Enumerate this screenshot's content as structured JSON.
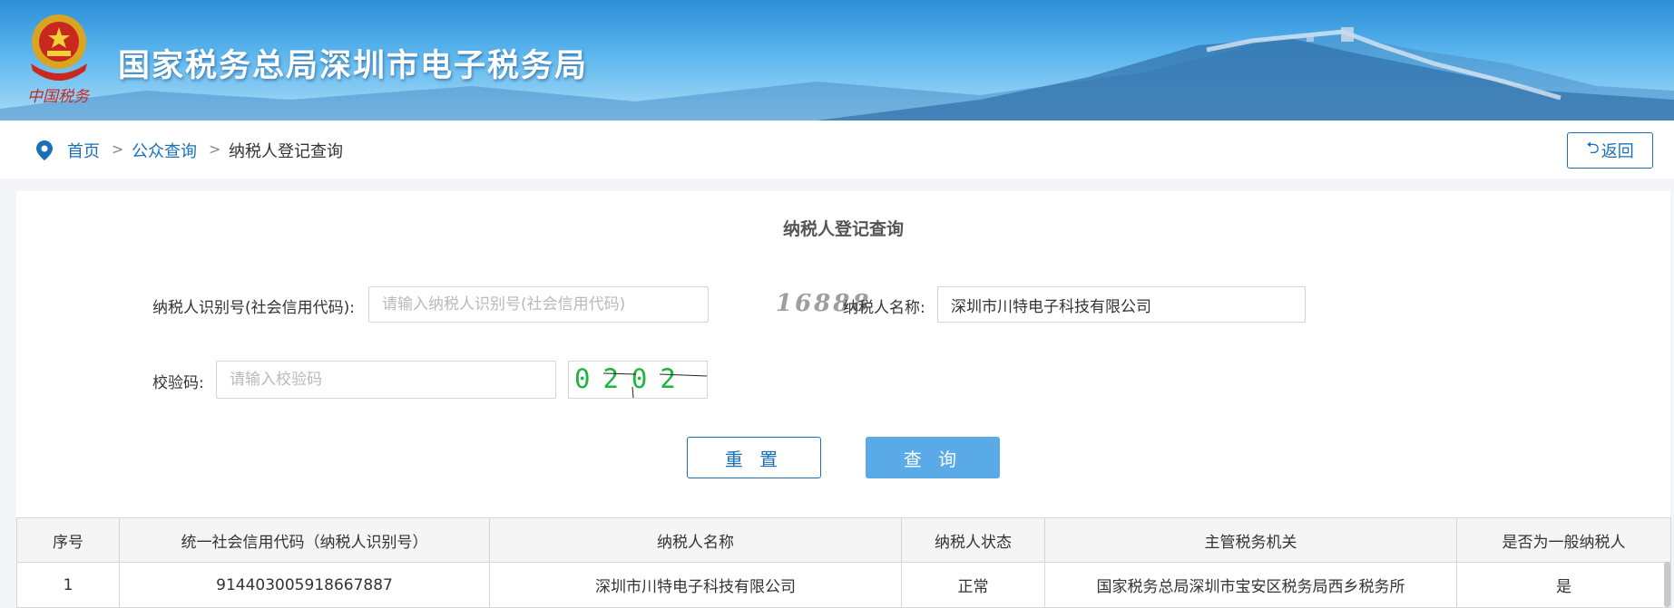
{
  "banner": {
    "title": "国家税务总局深圳市电子税务局",
    "logo_text": "中国税务",
    "emblem": "national-emblem-icon"
  },
  "breadcrumb": {
    "home": "首页",
    "public_query": "公众查询",
    "current": "纳税人登记查询",
    "separator": ">"
  },
  "back_label": "返回",
  "form": {
    "title": "纳税人登记查询",
    "taxpayer_id_label": "纳税人识别号(社会信用代码):",
    "taxpayer_id_placeholder": "请输入纳税人识别号(社会信用代码)",
    "taxpayer_id_value": "",
    "watermark": "16888",
    "taxpayer_name_label": "纳税人名称:",
    "taxpayer_name_value": "深圳市川特电子科技有限公司",
    "captcha_label": "校验码:",
    "captcha_placeholder": "请输入校验码",
    "captcha_value": "",
    "captcha_text": "0202",
    "reset_label": "重 置",
    "query_label": "查 询"
  },
  "table": {
    "headers": [
      "序号",
      "统一社会信用代码（纳税人识别号）",
      "纳税人名称",
      "纳税人状态",
      "主管税务机关",
      "是否为一般纳税人"
    ],
    "rows": [
      [
        "1",
        "914403005918667887",
        "深圳市川特电子科技有限公司",
        "正常",
        "国家税务总局深圳市宝安区税务局西乡税务所",
        "是"
      ]
    ]
  },
  "colors": {
    "accent": "#1a6fb8",
    "query_button": "#5aaae8",
    "captcha_text": "#1bb63c"
  }
}
